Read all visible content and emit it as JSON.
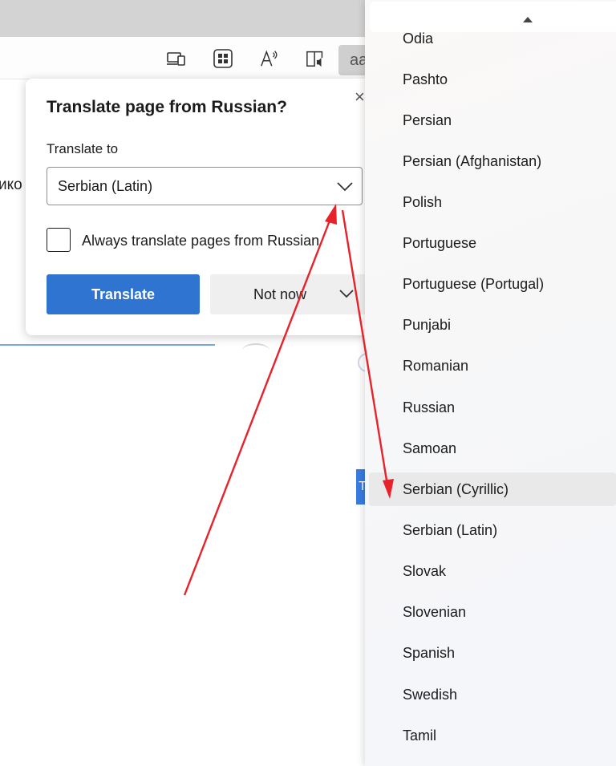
{
  "page": {
    "partial_text": "ико",
    "sidebar_button_glyph": "T"
  },
  "toolbar": {
    "reader_button_label": "aa"
  },
  "dialog": {
    "title": "Translate page from Russian?",
    "close_glyph": "×",
    "translate_to_label": "Translate to",
    "selected_language": "Serbian (Latin)",
    "always_translate_label": "Always translate pages from Russian",
    "always_translate_checked": false,
    "translate_button": "Translate",
    "not_now_button": "Not now",
    "accent_color": "#2f74d0"
  },
  "language_list": {
    "items": [
      "Odia",
      "Pashto",
      "Persian",
      "Persian (Afghanistan)",
      "Polish",
      "Portuguese",
      "Portuguese (Portugal)",
      "Punjabi",
      "Romanian",
      "Russian",
      "Samoan",
      "Serbian (Cyrillic)",
      "Serbian (Latin)",
      "Slovak",
      "Slovenian",
      "Spanish",
      "Swedish",
      "Tamil"
    ],
    "highlighted": "Serbian (Cyrillic)"
  },
  "annotations": {
    "arrow_color": "#e8222a"
  }
}
